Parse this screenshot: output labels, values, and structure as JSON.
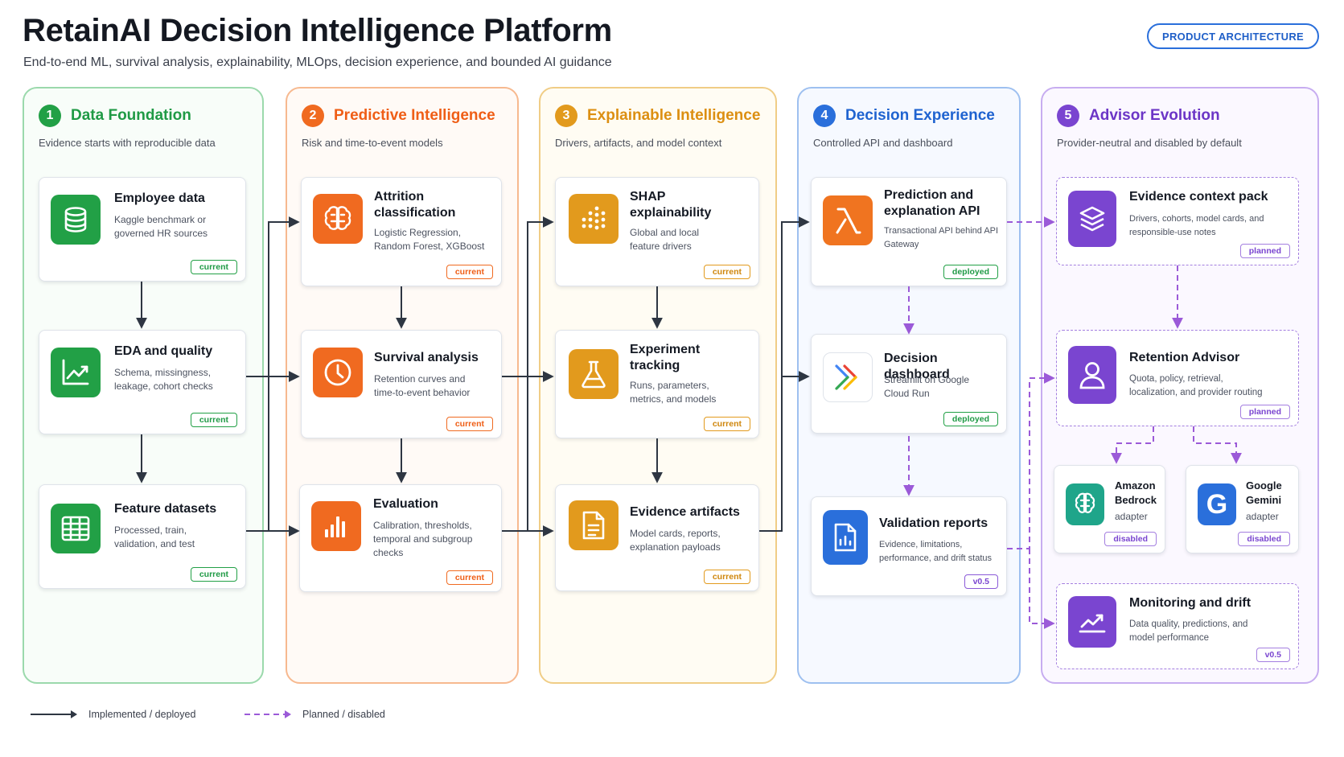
{
  "header": {
    "title": "RetainAI Decision Intelligence Platform",
    "subtitle": "End-to-end ML, survival analysis, explainability, MLOps, decision experience, and bounded AI guidance",
    "badge": "PRODUCT ARCHITECTURE"
  },
  "colors": {
    "green": "#22a046",
    "orange": "#f06a20",
    "amber": "#e29a1d",
    "blue": "#2a6fdb",
    "purple": "#7a45d0",
    "arrow": "#2e3642",
    "planned_arrow": "#9b5ad8"
  },
  "columns": [
    {
      "num": "1",
      "title": "Data Foundation",
      "subtitle": "Evidence starts with reproducible data",
      "cards": [
        {
          "title": "Employee data",
          "desc": "Kaggle benchmark or\ngoverned HR sources",
          "status": "current",
          "icon": "database-icon"
        },
        {
          "title": "EDA and quality",
          "desc": "Schema, missingness,\nleakage, cohort checks",
          "status": "current",
          "icon": "chart-line-icon"
        },
        {
          "title": "Feature datasets",
          "desc": "Processed, train,\nvalidation, and test",
          "status": "current",
          "icon": "table-grid-icon"
        }
      ]
    },
    {
      "num": "2",
      "title": "Predictive Intelligence",
      "subtitle": "Risk and time-to-event models",
      "cards": [
        {
          "title": "Attrition\nclassification",
          "desc": "Logistic Regression,\nRandom Forest, XGBoost",
          "status": "current",
          "icon": "brain-icon"
        },
        {
          "title": "Survival analysis",
          "desc": "Retention curves and\ntime-to-event behavior",
          "status": "current",
          "icon": "clock-icon"
        },
        {
          "title": "Evaluation",
          "desc": "Calibration, thresholds,\ntemporal and subgroup\nchecks",
          "status": "current",
          "icon": "bar-chart-icon"
        }
      ]
    },
    {
      "num": "3",
      "title": "Explainable Intelligence",
      "subtitle": "Drivers, artifacts, and model context",
      "cards": [
        {
          "title": "SHAP\nexplainability",
          "desc": "Global and local\nfeature drivers",
          "status": "current",
          "icon": "dot-grid-icon"
        },
        {
          "title": "Experiment\ntracking",
          "desc": "Runs, parameters,\nmetrics, and models",
          "status": "current",
          "icon": "flask-icon"
        },
        {
          "title": "Evidence artifacts",
          "desc": "Model cards, reports,\nexplanation payloads",
          "status": "current",
          "icon": "document-icon"
        }
      ]
    },
    {
      "num": "4",
      "title": "Decision Experience",
      "subtitle": "Controlled API and dashboard",
      "cards": [
        {
          "title": "Prediction and\nexplanation API",
          "desc": "Transactional API behind API\nGateway",
          "status": "deployed",
          "icon": "lambda-icon"
        },
        {
          "title": "Decision dashboard",
          "desc": "Streamlit on Google\nCloud Run",
          "status": "deployed",
          "icon": "cloud-run-icon"
        },
        {
          "title": "Validation reports",
          "desc": "Evidence, limitations,\nperformance, and drift status",
          "status": "v0.5",
          "icon": "report-icon"
        }
      ]
    },
    {
      "num": "5",
      "title": "Advisor Evolution",
      "subtitle": "Provider-neutral and disabled by default",
      "cards": [
        {
          "title": "Evidence context pack",
          "desc": "Drivers, cohorts, model cards, and\nresponsible-use notes",
          "status": "planned",
          "icon": "layers-icon"
        },
        {
          "title": "Retention Advisor",
          "desc": "Quota, policy, retrieval,\nlocalization, and provider routing",
          "status": "planned",
          "icon": "user-icon"
        },
        {
          "title": "Amazon\nBedrock",
          "desc": "adapter",
          "status": "disabled",
          "icon": "bedrock-icon"
        },
        {
          "title": "Google\nGemini",
          "desc": "adapter",
          "status": "disabled",
          "icon": "gemini-g-icon"
        },
        {
          "title": "Monitoring and drift",
          "desc": "Data quality, predictions, and\nmodel performance",
          "status": "v0.5",
          "icon": "trend-icon"
        }
      ]
    }
  ],
  "legend": {
    "implemented": "Implemented / deployed",
    "planned": "Planned / disabled"
  }
}
